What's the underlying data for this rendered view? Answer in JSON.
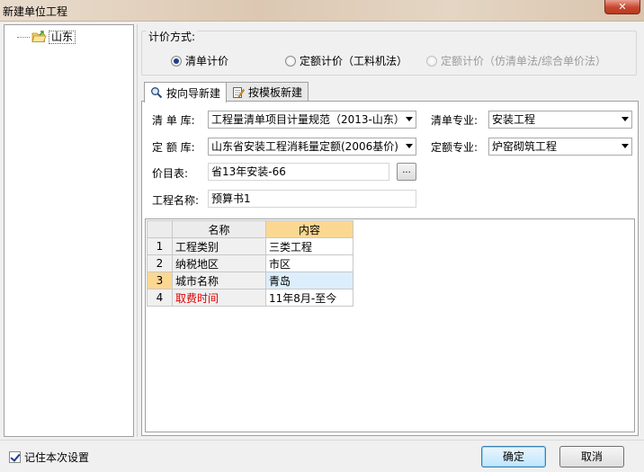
{
  "window": {
    "title": "新建单位工程",
    "close_label": "✕"
  },
  "tree": {
    "root_label": "山东"
  },
  "pricing": {
    "legend": "计价方式:",
    "options": [
      {
        "label": "清单计价",
        "selected": true,
        "enabled": true
      },
      {
        "label": "定额计价（工料机法）",
        "selected": false,
        "enabled": true
      },
      {
        "label": "定额计价（仿清单法/综合单价法）",
        "selected": false,
        "enabled": false
      }
    ]
  },
  "tabs": [
    {
      "label": "按向导新建",
      "icon": "wizard-icon",
      "active": true
    },
    {
      "label": "按模板新建",
      "icon": "template-icon",
      "active": false
    }
  ],
  "form": {
    "bill_lib_label": "清 单 库:",
    "bill_lib_value": "工程量清单项目计量规范（2013-山东）",
    "bill_spec_label": "清单专业:",
    "bill_spec_value": "安装工程",
    "quota_lib_label": "定 额 库:",
    "quota_lib_value": "山东省安装工程消耗量定额(2006基价)",
    "quota_spec_label": "定额专业:",
    "quota_spec_value": "炉窑砌筑工程",
    "price_table_label": "价目表:",
    "price_table_value": "省13年安装-66",
    "browse_label": "...",
    "project_name_label": "工程名称:",
    "project_name_value": "预算书1"
  },
  "grid": {
    "headers": [
      "名称",
      "内容"
    ],
    "rows": [
      {
        "no": "1",
        "name": "工程类别",
        "value": "三类工程"
      },
      {
        "no": "2",
        "name": "纳税地区",
        "value": "市区"
      },
      {
        "no": "3",
        "name": "城市名称",
        "value": "青岛"
      },
      {
        "no": "4",
        "name": "取费时间",
        "value": "11年8月-至今"
      }
    ]
  },
  "footer": {
    "remember_label": "记住本次设置",
    "remember_checked": true,
    "ok_label": "确定",
    "cancel_label": "取消"
  },
  "colors": {
    "accent_header": "#fbd892",
    "selected_cell": "#dceefc",
    "warning_text": "#e00000"
  }
}
